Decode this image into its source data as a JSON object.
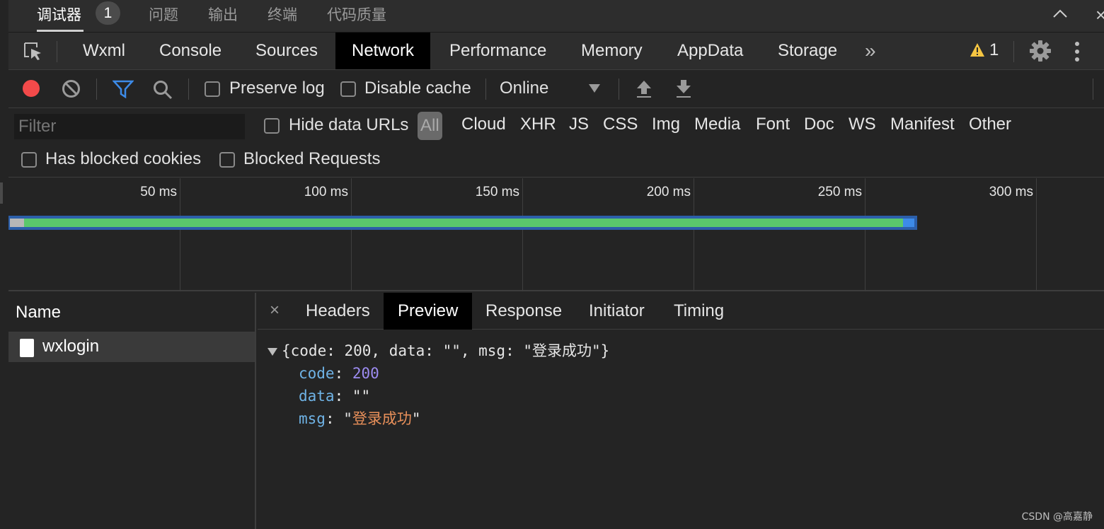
{
  "panel_tabs": {
    "debugger": "调试器",
    "debugger_badge": "1",
    "issues": "问题",
    "output": "输出",
    "terminal": "终端",
    "code_quality": "代码质量"
  },
  "devtools_tabs": [
    "Wxml",
    "Console",
    "Sources",
    "Network",
    "Performance",
    "Memory",
    "AppData",
    "Storage"
  ],
  "devtools_more": "»",
  "warning_count": "1",
  "toolbar": {
    "preserve_log": "Preserve log",
    "disable_cache": "Disable cache",
    "throttle": "Online"
  },
  "filter": {
    "placeholder": "Filter",
    "hide_data_urls": "Hide data URLs",
    "types": [
      "All",
      "Cloud",
      "XHR",
      "JS",
      "CSS",
      "Img",
      "Media",
      "Font",
      "Doc",
      "WS",
      "Manifest",
      "Other"
    ],
    "has_blocked_cookies": "Has blocked cookies",
    "blocked_requests": "Blocked Requests"
  },
  "timeline": {
    "ticks": [
      "50 ms",
      "100 ms",
      "150 ms",
      "200 ms",
      "250 ms",
      "300 ms"
    ]
  },
  "requests": {
    "column_name": "Name",
    "rows": [
      {
        "name": "wxlogin"
      }
    ]
  },
  "detail": {
    "close": "×",
    "tabs": [
      "Headers",
      "Preview",
      "Response",
      "Initiator",
      "Timing"
    ],
    "summary": "{code: 200, data: \"\", msg: \"登录成功\"}",
    "fields": {
      "code_key": "code",
      "code_value": "200",
      "data_key": "data",
      "data_value": "\"\"",
      "msg_key": "msg",
      "msg_value": "登录成功"
    }
  },
  "watermark": "CSDN @高嘉静",
  "colors": {
    "record": "#f34a4a",
    "filter_active": "#3d8be8",
    "bar_green": "#5ac86c",
    "bar_blue": "#3d8be8",
    "key": "#6fb3e6",
    "number": "#9d8cf2",
    "string": "#e9905a",
    "warning": "#f5c542"
  }
}
